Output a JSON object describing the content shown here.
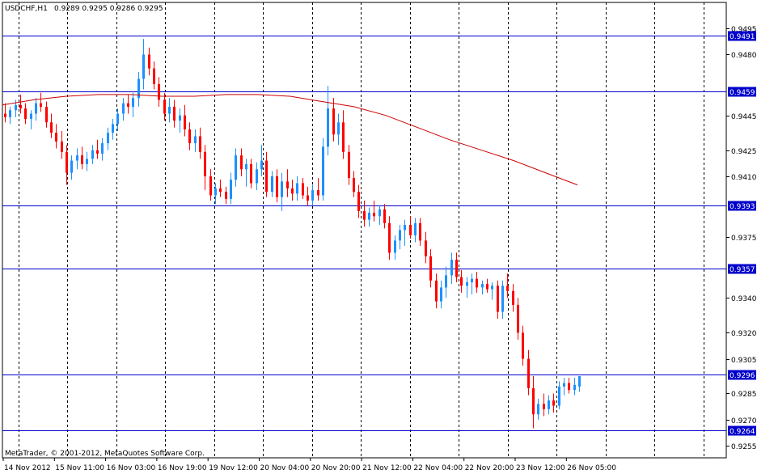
{
  "header": {
    "symbol": "USDCHF,H1",
    "ohlc": "0.9289 0.9295 0.9286 0.9295"
  },
  "footer": {
    "copyright": "MetaTrader, © 2001-2012, MetaQuotes Software Corp."
  },
  "colors": {
    "background": "#ffffff",
    "frame": "#000000",
    "bull": "#1e90ff",
    "bear": "#ff0000",
    "ma": "#cc0000",
    "hline": "#0000cc",
    "price_tag": "#0000cc"
  },
  "chart_data": {
    "type": "candlestick",
    "yaxis": {
      "min": 0.9248,
      "max": 0.951,
      "ticks": [
        "0.9495",
        "0.9480",
        "0.9445",
        "0.9425",
        "0.9410",
        "0.9375",
        "0.9340",
        "0.9320",
        "0.9305",
        "0.9285",
        "0.9270",
        "0.9255"
      ]
    },
    "xaxis": {
      "labels": [
        "14 Nov 2012",
        "15 Nov 11:00",
        "16 Nov 03:00",
        "16 Nov 19:00",
        "19 Nov 12:00",
        "20 Nov 04:00",
        "20 Nov 20:00",
        "21 Nov 12:00",
        "22 Nov 04:00",
        "22 Nov 20:00",
        "23 Nov 12:00",
        "26 Nov 05:00"
      ]
    },
    "price_levels": [
      "0.9491",
      "0.9459",
      "0.9393",
      "0.9357",
      "0.9296",
      "0.9264"
    ],
    "vertical_grid_count": 15,
    "moving_average": [
      0.9451,
      0.9454,
      0.9456,
      0.9457,
      0.9457,
      0.9456,
      0.9456,
      0.9457,
      0.9457,
      0.9456,
      0.9453,
      0.945,
      0.9445,
      0.9438,
      0.9431,
      0.9425,
      0.9419,
      0.9412,
      0.9405
    ],
    "candles": [
      [
        0.9446,
        0.9452,
        0.9441,
        0.9444
      ],
      [
        0.9444,
        0.945,
        0.944,
        0.9448
      ],
      [
        0.9448,
        0.9454,
        0.9444,
        0.9451
      ],
      [
        0.9451,
        0.9457,
        0.9446,
        0.9449
      ],
      [
        0.9449,
        0.9452,
        0.944,
        0.9443
      ],
      [
        0.9443,
        0.9448,
        0.9437,
        0.9446
      ],
      [
        0.9446,
        0.9455,
        0.9442,
        0.9452
      ],
      [
        0.9452,
        0.9458,
        0.9447,
        0.945
      ],
      [
        0.945,
        0.9453,
        0.9438,
        0.9441
      ],
      [
        0.9441,
        0.9446,
        0.9432,
        0.9435
      ],
      [
        0.9435,
        0.944,
        0.9426,
        0.943
      ],
      [
        0.943,
        0.9436,
        0.942,
        0.9424
      ],
      [
        0.9424,
        0.9428,
        0.9405,
        0.9412
      ],
      [
        0.9412,
        0.9422,
        0.9408,
        0.9419
      ],
      [
        0.9419,
        0.9426,
        0.9414,
        0.9422
      ],
      [
        0.9422,
        0.9427,
        0.9414,
        0.9417
      ],
      [
        0.9417,
        0.9424,
        0.9413,
        0.942
      ],
      [
        0.942,
        0.9428,
        0.9417,
        0.9425
      ],
      [
        0.9425,
        0.9431,
        0.942,
        0.9423
      ],
      [
        0.9423,
        0.9432,
        0.9419,
        0.9429
      ],
      [
        0.9429,
        0.9438,
        0.9425,
        0.9435
      ],
      [
        0.9435,
        0.9443,
        0.9431,
        0.944
      ],
      [
        0.944,
        0.9449,
        0.9436,
        0.9446
      ],
      [
        0.9446,
        0.9455,
        0.9442,
        0.9452
      ],
      [
        0.9452,
        0.9457,
        0.9446,
        0.945
      ],
      [
        0.945,
        0.9458,
        0.9444,
        0.9455
      ],
      [
        0.9455,
        0.947,
        0.945,
        0.9466
      ],
      [
        0.9466,
        0.9489,
        0.946,
        0.948
      ],
      [
        0.948,
        0.9484,
        0.9468,
        0.9472
      ],
      [
        0.9472,
        0.9476,
        0.946,
        0.9463
      ],
      [
        0.9463,
        0.9467,
        0.945,
        0.9454
      ],
      [
        0.9454,
        0.9458,
        0.9442,
        0.9446
      ],
      [
        0.9446,
        0.9455,
        0.9441,
        0.945
      ],
      [
        0.945,
        0.9454,
        0.9438,
        0.9442
      ],
      [
        0.9442,
        0.9449,
        0.9435,
        0.9445
      ],
      [
        0.9445,
        0.9451,
        0.9433,
        0.9437
      ],
      [
        0.9437,
        0.9441,
        0.9425,
        0.9429
      ],
      [
        0.9429,
        0.9437,
        0.9424,
        0.9433
      ],
      [
        0.9433,
        0.9438,
        0.942,
        0.9424
      ],
      [
        0.9424,
        0.9428,
        0.9402,
        0.941
      ],
      [
        0.941,
        0.9414,
        0.9396,
        0.9399
      ],
      [
        0.9399,
        0.9406,
        0.9394,
        0.9403
      ],
      [
        0.9403,
        0.9408,
        0.9398,
        0.9401
      ],
      [
        0.9401,
        0.9404,
        0.9394,
        0.9397
      ],
      [
        0.9397,
        0.9412,
        0.9394,
        0.9408
      ],
      [
        0.9408,
        0.9426,
        0.9404,
        0.9422
      ],
      [
        0.9422,
        0.9426,
        0.941,
        0.9414
      ],
      [
        0.9414,
        0.942,
        0.9404,
        0.9417
      ],
      [
        0.9417,
        0.942,
        0.9403,
        0.9406
      ],
      [
        0.9406,
        0.9418,
        0.9402,
        0.9414
      ],
      [
        0.9414,
        0.9428,
        0.941,
        0.9419
      ],
      [
        0.9419,
        0.9424,
        0.9398,
        0.9401
      ],
      [
        0.9401,
        0.9413,
        0.9398,
        0.941
      ],
      [
        0.941,
        0.9414,
        0.9395,
        0.9398
      ],
      [
        0.9398,
        0.9412,
        0.939,
        0.9407
      ],
      [
        0.9407,
        0.9414,
        0.9398,
        0.9403
      ],
      [
        0.9403,
        0.9408,
        0.9396,
        0.94
      ],
      [
        0.94,
        0.941,
        0.9396,
        0.9406
      ],
      [
        0.9406,
        0.9409,
        0.9397,
        0.9399
      ],
      [
        0.9399,
        0.9404,
        0.9393,
        0.9396
      ],
      [
        0.9396,
        0.9405,
        0.9393,
        0.9402
      ],
      [
        0.9402,
        0.9409,
        0.9396,
        0.9399
      ],
      [
        0.9399,
        0.9432,
        0.9396,
        0.9427
      ],
      [
        0.9427,
        0.9462,
        0.9422,
        0.9449
      ],
      [
        0.9449,
        0.9455,
        0.943,
        0.9434
      ],
      [
        0.9434,
        0.9446,
        0.9428,
        0.9441
      ],
      [
        0.9441,
        0.9448,
        0.942,
        0.9424
      ],
      [
        0.9424,
        0.9428,
        0.9405,
        0.9409
      ],
      [
        0.9409,
        0.9413,
        0.9398,
        0.9401
      ],
      [
        0.9401,
        0.9405,
        0.9386,
        0.939
      ],
      [
        0.939,
        0.9396,
        0.9381,
        0.9385
      ],
      [
        0.9385,
        0.9392,
        0.9381,
        0.9389
      ],
      [
        0.9389,
        0.9396,
        0.9384,
        0.9387
      ],
      [
        0.9387,
        0.9393,
        0.9382,
        0.9391
      ],
      [
        0.9391,
        0.9394,
        0.938,
        0.9383
      ],
      [
        0.9383,
        0.9387,
        0.9362,
        0.9366
      ],
      [
        0.9366,
        0.9376,
        0.9362,
        0.9373
      ],
      [
        0.9373,
        0.9382,
        0.9368,
        0.9379
      ],
      [
        0.9379,
        0.9385,
        0.937,
        0.9382
      ],
      [
        0.9382,
        0.9387,
        0.9374,
        0.9376
      ],
      [
        0.9376,
        0.9386,
        0.9372,
        0.9383
      ],
      [
        0.9383,
        0.9386,
        0.937,
        0.9373
      ],
      [
        0.9373,
        0.9378,
        0.936,
        0.9364
      ],
      [
        0.9364,
        0.9368,
        0.9346,
        0.935
      ],
      [
        0.935,
        0.9354,
        0.9334,
        0.9338
      ],
      [
        0.9338,
        0.935,
        0.9334,
        0.9346
      ],
      [
        0.9346,
        0.9358,
        0.934,
        0.9353
      ],
      [
        0.9353,
        0.9366,
        0.9348,
        0.9362
      ],
      [
        0.9362,
        0.9366,
        0.9349,
        0.9352
      ],
      [
        0.9352,
        0.9356,
        0.9343,
        0.9347
      ],
      [
        0.9347,
        0.9352,
        0.934,
        0.9349
      ],
      [
        0.9349,
        0.9354,
        0.9342,
        0.9351
      ],
      [
        0.9351,
        0.9355,
        0.9343,
        0.9346
      ],
      [
        0.9346,
        0.935,
        0.9342,
        0.9348
      ],
      [
        0.9348,
        0.9351,
        0.9343,
        0.9345
      ],
      [
        0.9345,
        0.9349,
        0.9339,
        0.9347
      ],
      [
        0.9347,
        0.935,
        0.9328,
        0.9332
      ],
      [
        0.9332,
        0.935,
        0.9328,
        0.9347
      ],
      [
        0.9347,
        0.9354,
        0.934,
        0.9344
      ],
      [
        0.9344,
        0.9348,
        0.9332,
        0.9336
      ],
      [
        0.9336,
        0.934,
        0.9316,
        0.932
      ],
      [
        0.932,
        0.9324,
        0.9301,
        0.9305
      ],
      [
        0.9305,
        0.931,
        0.9284,
        0.9288
      ],
      [
        0.9288,
        0.9295,
        0.9265,
        0.9273
      ],
      [
        0.9273,
        0.9282,
        0.927,
        0.9279
      ],
      [
        0.9279,
        0.9285,
        0.9272,
        0.9276
      ],
      [
        0.9276,
        0.9284,
        0.9273,
        0.9281
      ],
      [
        0.9281,
        0.9285,
        0.9274,
        0.9278
      ],
      [
        0.9278,
        0.9292,
        0.9276,
        0.9289
      ],
      [
        0.9289,
        0.9294,
        0.9284,
        0.9291
      ],
      [
        0.9291,
        0.9294,
        0.9285,
        0.9287
      ],
      [
        0.9287,
        0.9294,
        0.9284,
        0.929
      ],
      [
        0.9289,
        0.9295,
        0.9286,
        0.9295
      ]
    ]
  }
}
